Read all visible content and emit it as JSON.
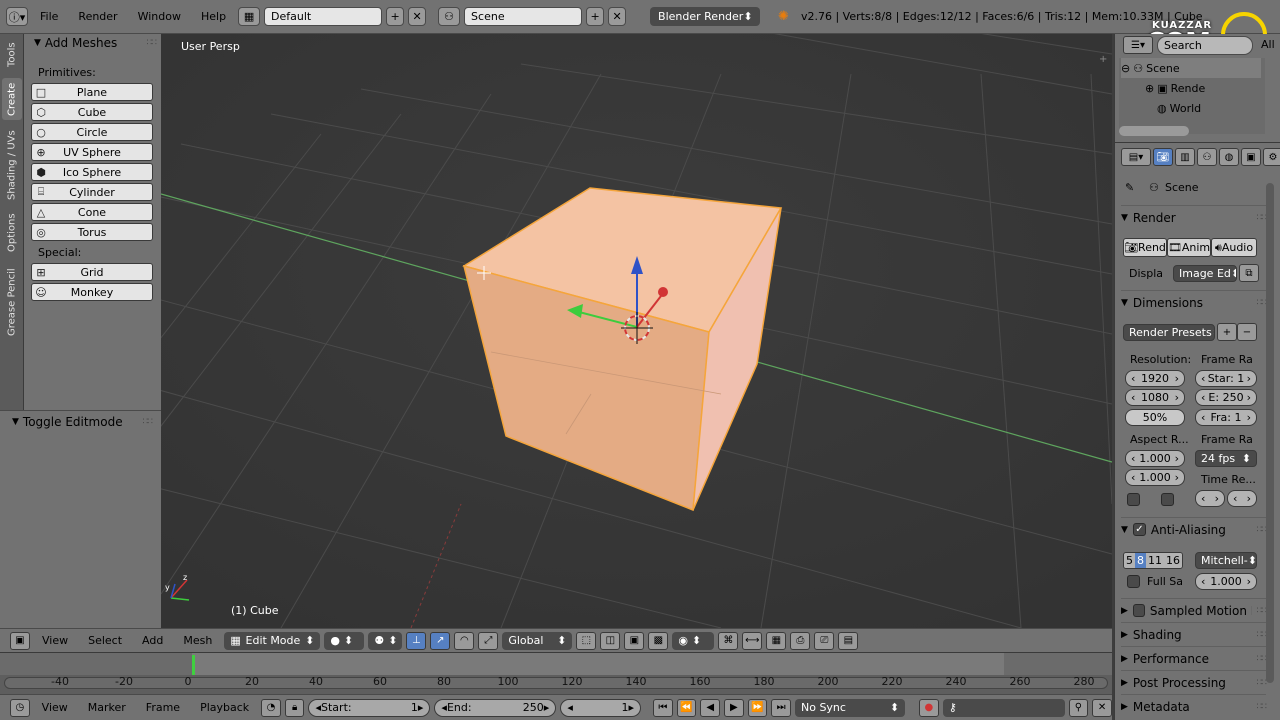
{
  "info_header": {
    "menus": [
      "File",
      "Render",
      "Window",
      "Help"
    ],
    "screen_layout": "Default",
    "scene": "Scene",
    "render_engine": "Blender Render",
    "stats": "v2.76 | Verts:8/8 | Edges:12/12 | Faces:6/6 | Tris:12 | Mem:10.33M | Cube"
  },
  "watermark": {
    "small": "KUAZZAR",
    "big": "COM"
  },
  "left_tabs": [
    "Tools",
    "Create",
    "Shading / UVs",
    "Options",
    "Grease Pencil"
  ],
  "tool_shelf": {
    "panel_title": "Add Meshes",
    "primitives_label": "Primitives:",
    "primitives": [
      {
        "label": "Plane",
        "icon": "plane-icon",
        "glyph": "□"
      },
      {
        "label": "Cube",
        "icon": "cube-icon",
        "glyph": "⬡"
      },
      {
        "label": "Circle",
        "icon": "circle-icon",
        "glyph": "○"
      },
      {
        "label": "UV Sphere",
        "icon": "uv-sphere-icon",
        "glyph": "⊕"
      },
      {
        "label": "Ico Sphere",
        "icon": "ico-sphere-icon",
        "glyph": "⬢"
      },
      {
        "label": "Cylinder",
        "icon": "cylinder-icon",
        "glyph": "⌸"
      },
      {
        "label": "Cone",
        "icon": "cone-icon",
        "glyph": "△"
      },
      {
        "label": "Torus",
        "icon": "torus-icon",
        "glyph": "◎"
      }
    ],
    "special_label": "Special:",
    "special": [
      {
        "label": "Grid",
        "icon": "grid-icon",
        "glyph": "⊞"
      },
      {
        "label": "Monkey",
        "icon": "monkey-icon",
        "glyph": "☺"
      }
    ],
    "operator_panel": "Toggle Editmode"
  },
  "viewport": {
    "view_label": "User Persp",
    "object_label": "(1) Cube"
  },
  "view3d_header": {
    "menus": [
      "View",
      "Select",
      "Add",
      "Mesh"
    ],
    "mode": "Edit Mode",
    "orientation": "Global"
  },
  "timeline": {
    "ticks": [
      "-40",
      "-20",
      "0",
      "20",
      "40",
      "60",
      "80",
      "100",
      "120",
      "140",
      "160",
      "180",
      "200",
      "220",
      "240",
      "260",
      "280"
    ],
    "menus": [
      "View",
      "Marker",
      "Frame",
      "Playback"
    ],
    "start_label": "Start:",
    "start": "1",
    "end_label": "End:",
    "end": "250",
    "current": "1",
    "sync": "No Sync"
  },
  "outliner": {
    "search": "Search",
    "filter": "All",
    "rows": [
      {
        "label": "Scene",
        "icon": "scene-icon"
      },
      {
        "label": "Rende",
        "icon": "render-layers-icon"
      },
      {
        "label": "World",
        "icon": "world-icon"
      }
    ]
  },
  "properties": {
    "context": "Scene",
    "render_panel": "Render",
    "render_buttons": [
      "Rend",
      "Anim",
      "Audio"
    ],
    "display_label": "Displa",
    "display_value": "Image Ed",
    "dimensions_panel": "Dimensions",
    "render_presets": "Render Presets",
    "resolution_label": "Resolution:",
    "res_x": "1920",
    "res_y": "1080",
    "res_pct": "50%",
    "frame_range_label": "Frame Ra",
    "frame_start": "Star: 1",
    "frame_end": "E: 250",
    "frame_step": "Fra: 1",
    "aspect_label": "Aspect R...",
    "aspect_x": "1.000",
    "aspect_y": "1.000",
    "frame_rate_label": "Frame Ra",
    "fps": "24 fps",
    "time_remap_label": "Time Re...",
    "aa_panel": "Anti-Aliasing",
    "aa_samples": [
      "5",
      "8",
      "11",
      "16"
    ],
    "aa_filter": "Mitchell-",
    "full_sample": "Full Sa",
    "filter_size": "1.000",
    "collapsed_panels": [
      "Sampled Motion Bl",
      "Shading",
      "Performance",
      "Post Processing",
      "Metadata"
    ]
  }
}
